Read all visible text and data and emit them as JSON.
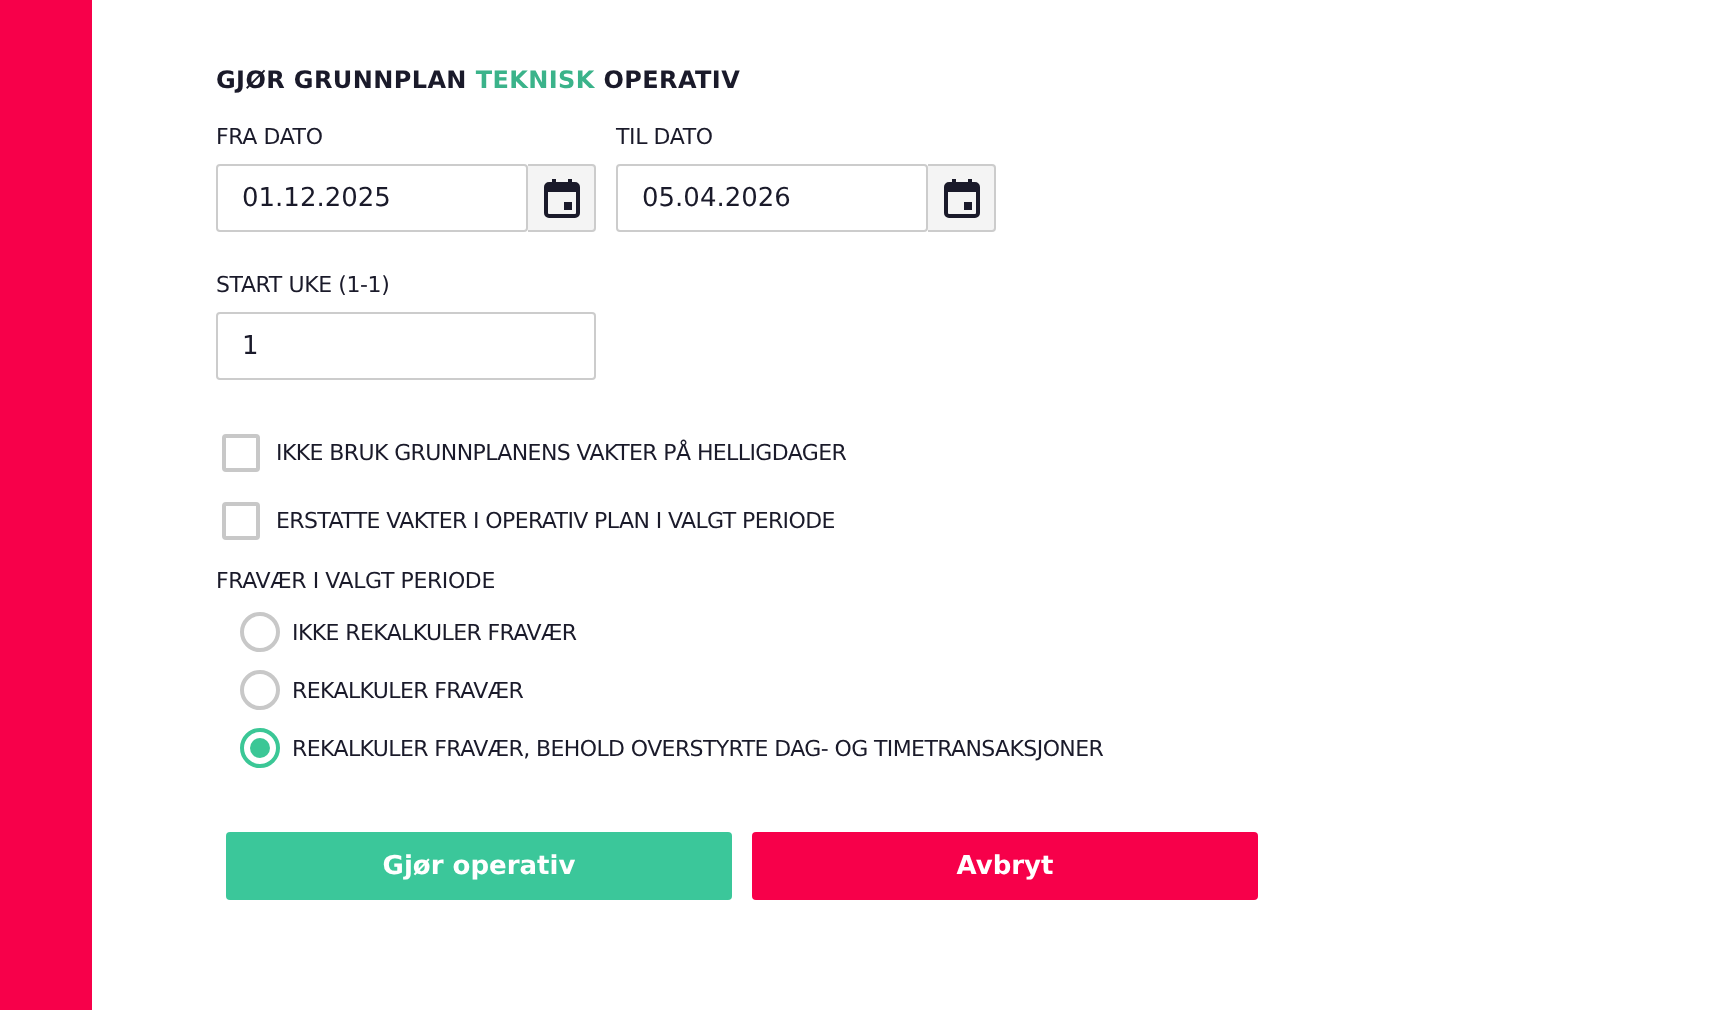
{
  "title": {
    "before": "GJØR GRUNNPLAN",
    "highlight": "TEKNISK",
    "after": "OPERATIV"
  },
  "date_fields": [
    {
      "label": "FRA DATO",
      "value": "01.12.2025"
    },
    {
      "label": "TIL DATO",
      "value": "05.04.2026"
    }
  ],
  "start_week": {
    "label": "START UKE (1-1)",
    "value": "1"
  },
  "checkboxes": [
    {
      "label": "IKKE BRUK GRUNNPLANENS VAKTER PÅ HELLIGDAGER",
      "checked": false
    },
    {
      "label": "ERSTATTE VAKTER I OPERATIV PLAN I VALGT PERIODE",
      "checked": false
    }
  ],
  "absence": {
    "label": "FRAVÆR I VALGT PERIODE",
    "options": [
      {
        "label": "IKKE REKALKULER FRAVÆR",
        "selected": false
      },
      {
        "label": "REKALKULER FRAVÆR",
        "selected": false
      },
      {
        "label": "REKALKULER FRAVÆR, BEHOLD OVERSTYRTE DAG- OG TIMETRANSAKSJONER",
        "selected": true
      }
    ]
  },
  "buttons": [
    {
      "label": "Gjør operativ",
      "kind": "primary"
    },
    {
      "label": "Avbryt",
      "kind": "cancel"
    }
  ]
}
